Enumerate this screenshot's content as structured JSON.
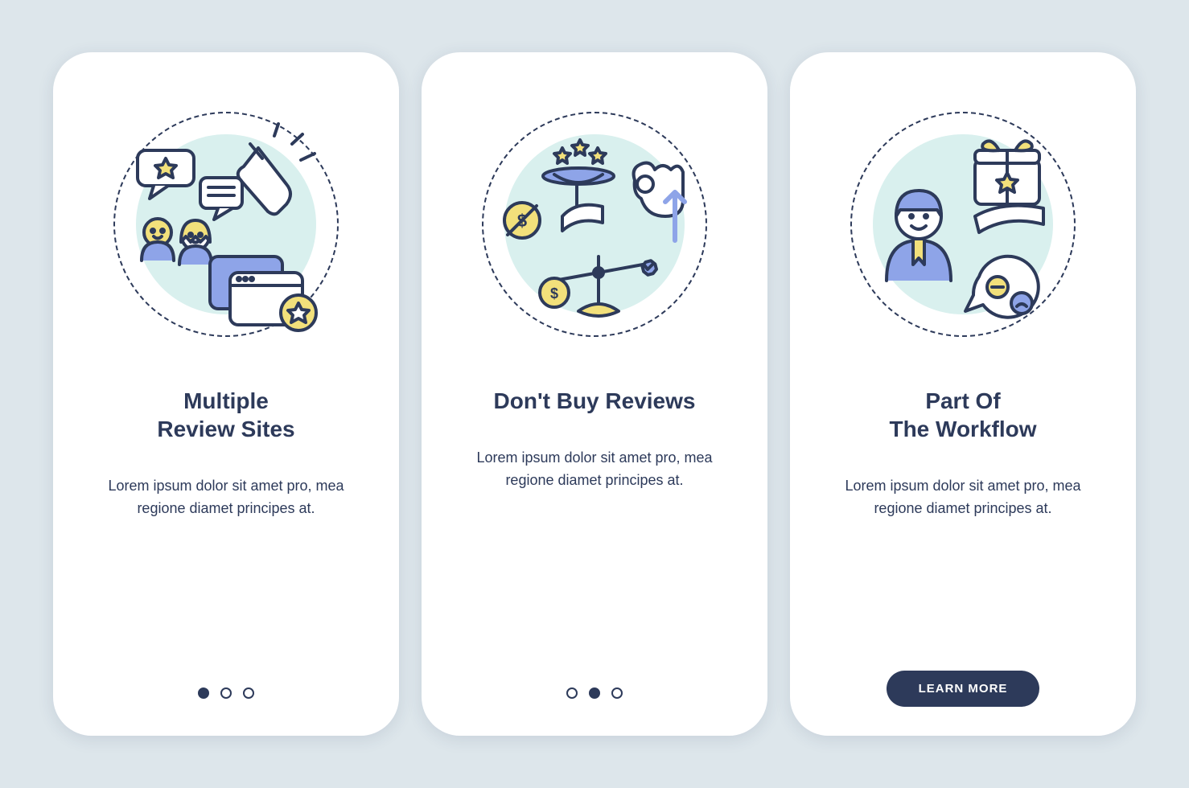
{
  "colors": {
    "stroke": "#2d3a5a",
    "blue": "#8ea4e8",
    "yellow": "#f2e07b",
    "teal": "#d9f0ee"
  },
  "screens": [
    {
      "title": "Multiple\nReview Sites",
      "desc": "Lorem ipsum dolor sit amet pro, mea regione diamet principes at.",
      "page_index": 0,
      "show_dots": true
    },
    {
      "title": "Don't Buy Reviews",
      "desc": "Lorem ipsum dolor sit amet pro, mea regione diamet principes at.",
      "page_index": 1,
      "show_dots": true
    },
    {
      "title": "Part Of\nThe Workflow",
      "desc": "Lorem ipsum dolor sit amet pro, mea regione diamet principes at.",
      "page_index": 2,
      "show_dots": false,
      "cta": "LEARN MORE"
    }
  ]
}
